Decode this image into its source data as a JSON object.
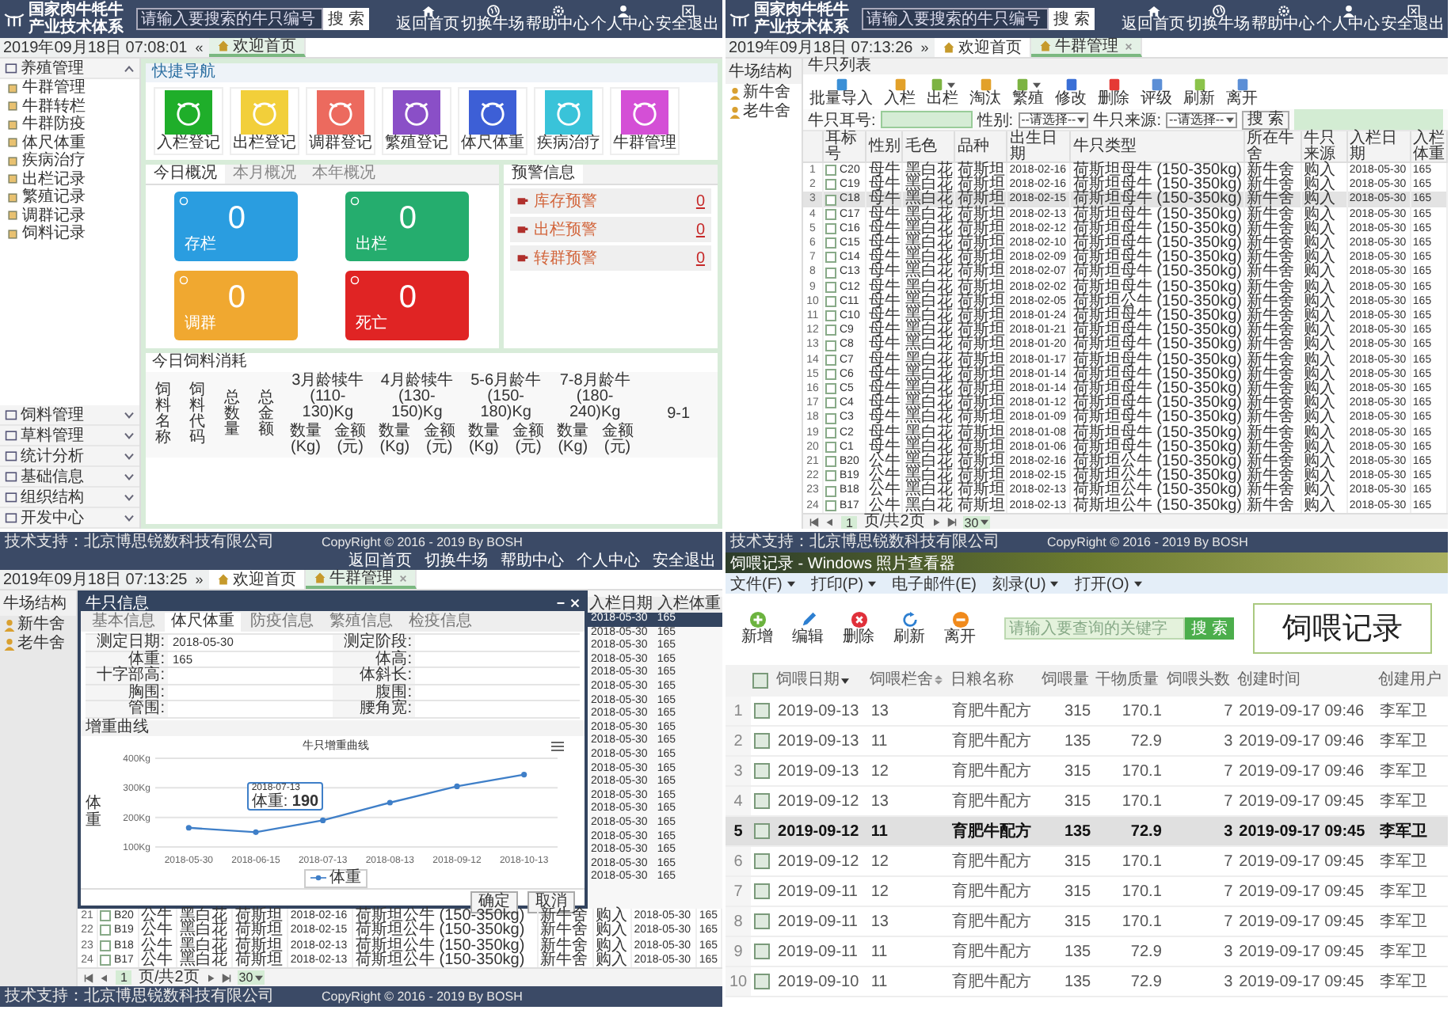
{
  "dashboard": {
    "header": {
      "title": "国家肉牛牦牛产业技术体系",
      "search_placeholder": "请输入要搜索的牛只编号",
      "search_button": "搜 索",
      "nav": [
        "返回首页",
        "切换牛场",
        "帮助中心",
        "个人中心",
        "安全退出"
      ]
    },
    "date": "2019年09月18日 07:08:01",
    "collapse": "«",
    "tabs": [
      {
        "label": "欢迎首页",
        "selected": true
      }
    ],
    "sidebar": [
      {
        "label": "养殖管理",
        "expanded": true,
        "items": [
          "牛群管理",
          "牛群转栏",
          "牛群防疫",
          "体尺体重",
          "疾病治疗",
          "出栏记录",
          "繁殖记录",
          "调群记录",
          "饲料记录"
        ]
      },
      {
        "label": "饲料管理",
        "expanded": false
      },
      {
        "label": "草料管理",
        "expanded": false
      },
      {
        "label": "统计分析",
        "expanded": false
      },
      {
        "label": "基础信息",
        "expanded": false
      },
      {
        "label": "组织结构",
        "expanded": false
      },
      {
        "label": "开发中心",
        "expanded": false
      }
    ],
    "quick_nav": {
      "title": "快捷导航",
      "tiles": [
        {
          "label": "入栏登记",
          "color": "#1fae2a"
        },
        {
          "label": "出栏登记",
          "color": "#f2cf3a"
        },
        {
          "label": "调群登记",
          "color": "#ec6a5e"
        },
        {
          "label": "繁殖登记",
          "color": "#8a4fc7"
        },
        {
          "label": "体尺体重",
          "color": "#3d5fd6"
        },
        {
          "label": "疾病治疗",
          "color": "#39c3d9"
        },
        {
          "label": "牛群管理",
          "color": "#d44fd6"
        }
      ]
    },
    "overview": {
      "tabs": [
        {
          "label": "今日概况",
          "selected": true
        },
        {
          "label": "本月概况",
          "selected": false
        },
        {
          "label": "本年概况",
          "selected": false
        }
      ],
      "cards": [
        {
          "value": "0",
          "label": "存栏",
          "color": "#2a9de0"
        },
        {
          "value": "0",
          "label": "出栏",
          "color": "#25ad6e"
        },
        {
          "value": "0",
          "label": "调群",
          "color": "#f0a830"
        },
        {
          "value": "0",
          "label": "死亡",
          "color": "#e02424"
        }
      ]
    },
    "warnings": {
      "title": "预警信息",
      "items": [
        {
          "label": "库存预警",
          "count": "0"
        },
        {
          "label": "出栏预警",
          "count": "0"
        },
        {
          "label": "转群预警",
          "count": "0"
        }
      ]
    },
    "feed": {
      "title": "今日饲料消耗",
      "columns": [
        "饲料名称",
        "饲料代码",
        "总数量",
        "总金额"
      ],
      "groups": [
        {
          "label": "3月龄犊牛(110-130)Kg",
          "sub": [
            "数量(Kg)",
            "金额(元)"
          ]
        },
        {
          "label": "4月龄犊牛(130-150)Kg",
          "sub": [
            "数量(Kg)",
            "金额(元)"
          ]
        },
        {
          "label": "5-6月龄牛(150-180)Kg",
          "sub": [
            "数量(Kg)",
            "金额(元)"
          ]
        },
        {
          "label": "7-8月龄牛(180-240)Kg",
          "sub": [
            "数量(Kg)",
            "金额(元)"
          ]
        },
        {
          "label": "9-1"
        }
      ]
    }
  },
  "cattle_list": {
    "header": {
      "title": "国家肉牛牦牛产业技术体系",
      "search_placeholder": "请输入要搜索的牛只编号",
      "search_button": "搜 索",
      "nav": [
        "返回首页",
        "切换牛场",
        "帮助中心",
        "个人中心",
        "安全退出"
      ]
    },
    "date": "2019年09月18日 07:13:26",
    "expand": "»",
    "tabs": [
      {
        "label": "欢迎首页",
        "selected": false,
        "closable": false
      },
      {
        "label": "牛群管理",
        "selected": true,
        "closable": true
      }
    ],
    "tree": {
      "title": "牛场结构",
      "items": [
        "新牛舍",
        "老牛舍"
      ]
    },
    "title": "牛只列表",
    "toolbar": [
      {
        "label": "批量导入",
        "color": "#3a8fd6",
        "dropdown": false
      },
      {
        "label": "入栏",
        "color": "#e2a12a",
        "dropdown": false
      },
      {
        "label": "出栏",
        "color": "#7cb342",
        "dropdown": true
      },
      {
        "label": "淘汰",
        "color": "#e2a12a",
        "dropdown": false
      },
      {
        "label": "繁殖",
        "color": "#7cb342",
        "dropdown": true
      },
      {
        "label": "修改",
        "color": "#3a6fd6",
        "dropdown": false
      },
      {
        "label": "删除",
        "color": "#e53935",
        "dropdown": false
      },
      {
        "label": "评级",
        "color": "#5c8fd6",
        "dropdown": false
      },
      {
        "label": "刷新",
        "color": "#8bc34a",
        "dropdown": false
      },
      {
        "label": "离开",
        "color": "#5c8fd6",
        "dropdown": false
      }
    ],
    "filter": {
      "ear_label": "牛只耳号:",
      "sex_label": "性别:",
      "sex_value": "--请选择--",
      "source_label": "牛只来源:",
      "source_value": "--请选择--",
      "button": "搜 索"
    },
    "columns": [
      "耳标号",
      "性别",
      "毛色",
      "品种",
      "出生日期",
      "牛只类型",
      "所在牛舍",
      "牛只来源",
      "入栏日期",
      "入栏体重"
    ],
    "rows": [
      {
        "n": "1",
        "tag": "C20",
        "sex": "母牛",
        "coat": "黑白花",
        "breed": "荷斯坦",
        "birth": "2018-02-16",
        "type": "荷斯坦母牛 (150-350kg)",
        "barn": "新牛舍",
        "source": "购入",
        "date": "2018-05-30",
        "weight": "165",
        "checked": false,
        "selected": false
      },
      {
        "n": "2",
        "tag": "C19",
        "sex": "母牛",
        "coat": "黑白花",
        "breed": "荷斯坦",
        "birth": "2018-02-16",
        "type": "荷斯坦母牛 (150-350kg)",
        "barn": "新牛舍",
        "source": "购入",
        "date": "2018-05-30",
        "weight": "165",
        "checked": false,
        "selected": false
      },
      {
        "n": "3",
        "tag": "C18",
        "sex": "母牛",
        "coat": "黑白花",
        "breed": "荷斯坦",
        "birth": "2018-02-15",
        "type": "荷斯坦母牛 (150-350kg)",
        "barn": "新牛舍",
        "source": "购入",
        "date": "2018-05-30",
        "weight": "165",
        "checked": false,
        "selected": true
      },
      {
        "n": "4",
        "tag": "C17",
        "sex": "母牛",
        "coat": "黑白花",
        "breed": "荷斯坦",
        "birth": "2018-02-13",
        "type": "荷斯坦母牛 (150-350kg)",
        "barn": "新牛舍",
        "source": "购入",
        "date": "2018-05-30",
        "weight": "165",
        "checked": false,
        "selected": false
      },
      {
        "n": "5",
        "tag": "C16",
        "sex": "母牛",
        "coat": "黑白花",
        "breed": "荷斯坦",
        "birth": "2018-02-12",
        "type": "荷斯坦母牛 (150-350kg)",
        "barn": "新牛舍",
        "source": "购入",
        "date": "2018-05-30",
        "weight": "165",
        "checked": false,
        "selected": false
      },
      {
        "n": "6",
        "tag": "C15",
        "sex": "母牛",
        "coat": "黑白花",
        "breed": "荷斯坦",
        "birth": "2018-02-10",
        "type": "荷斯坦母牛 (150-350kg)",
        "barn": "新牛舍",
        "source": "购入",
        "date": "2018-05-30",
        "weight": "165",
        "checked": false,
        "selected": false
      },
      {
        "n": "7",
        "tag": "C14",
        "sex": "母牛",
        "coat": "黑白花",
        "breed": "荷斯坦",
        "birth": "2018-02-09",
        "type": "荷斯坦母牛 (150-350kg)",
        "barn": "新牛舍",
        "source": "购入",
        "date": "2018-05-30",
        "weight": "165",
        "checked": false,
        "selected": false
      },
      {
        "n": "8",
        "tag": "C13",
        "sex": "母牛",
        "coat": "黑白花",
        "breed": "荷斯坦",
        "birth": "2018-02-07",
        "type": "荷斯坦母牛 (150-350kg)",
        "barn": "新牛舍",
        "source": "购入",
        "date": "2018-05-30",
        "weight": "165",
        "checked": false,
        "selected": false
      },
      {
        "n": "9",
        "tag": "C12",
        "sex": "母牛",
        "coat": "黑白花",
        "breed": "荷斯坦",
        "birth": "2018-02-02",
        "type": "荷斯坦母牛 (150-350kg)",
        "barn": "新牛舍",
        "source": "购入",
        "date": "2018-05-30",
        "weight": "165",
        "checked": false,
        "selected": false
      },
      {
        "n": "10",
        "tag": "C11",
        "sex": "母牛",
        "coat": "黑白花",
        "breed": "荷斯坦",
        "birth": "2018-02-05",
        "type": "荷斯坦公牛 (150-350kg)",
        "barn": "新牛舍",
        "source": "购入",
        "date": "2018-05-30",
        "weight": "165",
        "checked": false,
        "selected": false
      },
      {
        "n": "11",
        "tag": "C10",
        "sex": "母牛",
        "coat": "黑白花",
        "breed": "荷斯坦",
        "birth": "2018-01-24",
        "type": "荷斯坦母牛 (150-350kg)",
        "barn": "新牛舍",
        "source": "购入",
        "date": "2018-05-30",
        "weight": "165",
        "checked": false,
        "selected": false
      },
      {
        "n": "12",
        "tag": "C9",
        "sex": "母牛",
        "coat": "黑白花",
        "breed": "荷斯坦",
        "birth": "2018-01-21",
        "type": "荷斯坦母牛 (150-350kg)",
        "barn": "新牛舍",
        "source": "购入",
        "date": "2018-05-30",
        "weight": "165",
        "checked": false,
        "selected": false
      },
      {
        "n": "13",
        "tag": "C8",
        "sex": "母牛",
        "coat": "黑白花",
        "breed": "荷斯坦",
        "birth": "2018-01-20",
        "type": "荷斯坦母牛 (150-350kg)",
        "barn": "新牛舍",
        "source": "购入",
        "date": "2018-05-30",
        "weight": "165",
        "checked": false,
        "selected": false
      },
      {
        "n": "14",
        "tag": "C7",
        "sex": "母牛",
        "coat": "黑白花",
        "breed": "荷斯坦",
        "birth": "2018-01-17",
        "type": "荷斯坦母牛 (150-350kg)",
        "barn": "新牛舍",
        "source": "购入",
        "date": "2018-05-30",
        "weight": "165",
        "checked": false,
        "selected": false
      },
      {
        "n": "15",
        "tag": "C6",
        "sex": "母牛",
        "coat": "黑白花",
        "breed": "荷斯坦",
        "birth": "2018-01-14",
        "type": "荷斯坦母牛 (150-350kg)",
        "barn": "新牛舍",
        "source": "购入",
        "date": "2018-05-30",
        "weight": "165",
        "checked": false,
        "selected": false
      },
      {
        "n": "16",
        "tag": "C5",
        "sex": "母牛",
        "coat": "黑白花",
        "breed": "荷斯坦",
        "birth": "2018-01-14",
        "type": "荷斯坦母牛 (150-350kg)",
        "barn": "新牛舍",
        "source": "购入",
        "date": "2018-05-30",
        "weight": "165",
        "checked": false,
        "selected": false
      },
      {
        "n": "17",
        "tag": "C4",
        "sex": "母牛",
        "coat": "黑白花",
        "breed": "荷斯坦",
        "birth": "2018-01-12",
        "type": "荷斯坦母牛 (150-350kg)",
        "barn": "新牛舍",
        "source": "购入",
        "date": "2018-05-30",
        "weight": "165",
        "checked": false,
        "selected": false
      },
      {
        "n": "18",
        "tag": "C3",
        "sex": "母牛",
        "coat": "黑白花",
        "breed": "荷斯坦",
        "birth": "2018-01-09",
        "type": "荷斯坦母牛 (150-350kg)",
        "barn": "新牛舍",
        "source": "购入",
        "date": "2018-05-30",
        "weight": "165",
        "checked": false,
        "selected": false
      },
      {
        "n": "19",
        "tag": "C2",
        "sex": "母牛",
        "coat": "黑白花",
        "breed": "荷斯坦",
        "birth": "2018-01-08",
        "type": "荷斯坦母牛 (150-350kg)",
        "barn": "新牛舍",
        "source": "购入",
        "date": "2018-05-30",
        "weight": "165",
        "checked": false,
        "selected": false
      },
      {
        "n": "20",
        "tag": "C1",
        "sex": "母牛",
        "coat": "黑白花",
        "breed": "荷斯坦",
        "birth": "2018-01-06",
        "type": "荷斯坦母牛 (150-350kg)",
        "barn": "新牛舍",
        "source": "购入",
        "date": "2018-05-30",
        "weight": "165",
        "checked": false,
        "selected": false
      },
      {
        "n": "21",
        "tag": "B20",
        "sex": "公牛",
        "coat": "黑白花",
        "breed": "荷斯坦",
        "birth": "2018-02-16",
        "type": "荷斯坦公牛 (150-350kg)",
        "barn": "新牛舍",
        "source": "购入",
        "date": "2018-05-30",
        "weight": "165",
        "checked": false,
        "selected": false
      },
      {
        "n": "22",
        "tag": "B19",
        "sex": "公牛",
        "coat": "黑白花",
        "breed": "荷斯坦",
        "birth": "2018-02-15",
        "type": "荷斯坦公牛 (150-350kg)",
        "barn": "新牛舍",
        "source": "购入",
        "date": "2018-05-30",
        "weight": "165",
        "checked": false,
        "selected": false
      },
      {
        "n": "23",
        "tag": "B18",
        "sex": "公牛",
        "coat": "黑白花",
        "breed": "荷斯坦",
        "birth": "2018-02-13",
        "type": "荷斯坦公牛 (150-350kg)",
        "barn": "新牛舍",
        "source": "购入",
        "date": "2018-05-30",
        "weight": "165",
        "checked": false,
        "selected": false
      },
      {
        "n": "24",
        "tag": "B17",
        "sex": "公牛",
        "coat": "黑白花",
        "breed": "荷斯坦",
        "birth": "2018-02-13",
        "type": "荷斯坦公牛 (150-350kg)",
        "barn": "新牛舍",
        "source": "购入",
        "date": "2018-05-30",
        "weight": "165",
        "checked": false,
        "selected": false
      }
    ],
    "pager": {
      "page": "1",
      "text": "页/共2页",
      "size": "30"
    }
  },
  "cattle_modal": {
    "footer": {
      "left": "技术支持：北京博思锐数科技有限公司",
      "right": "CopyRight © 2016 - 2019 By BOSH"
    },
    "nav": [
      "返回首页",
      "切换牛场",
      "帮助中心",
      "个人中心",
      "安全退出"
    ],
    "date": "2019年09月18日 07:13:25",
    "expand": "»",
    "tabs": [
      {
        "label": "欢迎首页",
        "selected": false,
        "closable": false
      },
      {
        "label": "牛群管理",
        "selected": true,
        "closable": true
      }
    ],
    "tree": {
      "title": "牛场结构",
      "items": [
        "新牛舍",
        "老牛舍"
      ]
    },
    "modal": {
      "title": "牛只信息",
      "tabs": [
        {
          "label": "基本信息",
          "selected": false
        },
        {
          "label": "体尺体重",
          "selected": true
        },
        {
          "label": "防疫信息",
          "selected": false
        },
        {
          "label": "繁殖信息",
          "selected": false
        },
        {
          "label": "检疫信息",
          "selected": false
        }
      ],
      "fields": [
        {
          "label": "测定日期:",
          "value": "2018-05-30"
        },
        {
          "label": "测定阶段:"
        },
        {
          "label": "体重:",
          "value": "165"
        },
        {
          "label": "体高:"
        },
        {
          "label": "十字部高:"
        },
        {
          "label": "体斜长:"
        },
        {
          "label": "胸围:"
        },
        {
          "label": "腹围:"
        },
        {
          "label": "管围:"
        },
        {
          "label": "腰角宽:"
        }
      ],
      "section": "增重曲线",
      "chart_data": {
        "type": "line",
        "title": "牛只增重曲线",
        "ylabel": "体重",
        "categories": [
          "2018-05-30",
          "2018-06-15",
          "2018-07-13",
          "2018-08-13",
          "2018-09-12",
          "2018-10-13"
        ],
        "series": [
          {
            "name": "体重",
            "color": "#3f7fc8",
            "marker": "circle",
            "values": [
              165,
              150,
              190,
              250,
              305,
              345
            ]
          }
        ],
        "ylim": [
          100,
          400
        ],
        "yticks": [
          {
            "value": 100,
            "label": "100Kg"
          },
          {
            "value": 200,
            "label": "200Kg"
          },
          {
            "value": 300,
            "label": "300Kg"
          },
          {
            "value": 400,
            "label": "400Kg"
          }
        ],
        "annotations": [
          {
            "x": "2018-07-13",
            "y": 190,
            "text": "体重: **190**"
          }
        ]
      },
      "buttons": [
        "确定",
        "取消"
      ]
    },
    "side_columns": [
      "入栏日期",
      "入栏体重"
    ],
    "side_rows": [
      {
        "date": "2018-05-30",
        "weight": "165",
        "selected": true
      },
      {
        "date": "2018-05-30",
        "weight": "165",
        "selected": false
      },
      {
        "date": "2018-05-30",
        "weight": "165",
        "selected": false
      },
      {
        "date": "2018-05-30",
        "weight": "165",
        "selected": false
      },
      {
        "date": "2018-05-30",
        "weight": "165",
        "selected": false
      },
      {
        "date": "2018-05-30",
        "weight": "165",
        "selected": false
      },
      {
        "date": "2018-05-30",
        "weight": "165",
        "selected": false
      },
      {
        "date": "2018-05-30",
        "weight": "165",
        "selected": false
      },
      {
        "date": "2018-05-30",
        "weight": "165",
        "selected": false
      },
      {
        "date": "2018-05-30",
        "weight": "165",
        "selected": false
      },
      {
        "date": "2018-05-30",
        "weight": "165",
        "selected": false
      },
      {
        "date": "2018-05-30",
        "weight": "165",
        "selected": false
      },
      {
        "date": "2018-05-30",
        "weight": "165",
        "selected": false
      },
      {
        "date": "2018-05-30",
        "weight": "165",
        "selected": false
      },
      {
        "date": "2018-05-30",
        "weight": "165",
        "selected": false
      },
      {
        "date": "2018-05-30",
        "weight": "165",
        "selected": false
      },
      {
        "date": "2018-05-30",
        "weight": "165",
        "selected": false
      },
      {
        "date": "2018-05-30",
        "weight": "165",
        "selected": false
      },
      {
        "date": "2018-05-30",
        "weight": "165",
        "selected": false
      },
      {
        "date": "2018-05-30",
        "weight": "165",
        "selected": false
      }
    ],
    "rows": [
      {
        "n": "21",
        "tag": "B20",
        "sex": "公牛",
        "coat": "黑白花",
        "breed": "荷斯坦",
        "birth": "2018-02-16",
        "type": "荷斯坦公牛 (150-350kg)",
        "barn": "新牛舍",
        "source": "购入",
        "date": "2018-05-30",
        "weight": "165",
        "checked": false
      },
      {
        "n": "22",
        "tag": "B19",
        "sex": "公牛",
        "coat": "黑白花",
        "breed": "荷斯坦",
        "birth": "2018-02-15",
        "type": "荷斯坦公牛 (150-350kg)",
        "barn": "新牛舍",
        "source": "购入",
        "date": "2018-05-30",
        "weight": "165",
        "checked": false
      },
      {
        "n": "23",
        "tag": "B18",
        "sex": "公牛",
        "coat": "黑白花",
        "breed": "荷斯坦",
        "birth": "2018-02-13",
        "type": "荷斯坦公牛 (150-350kg)",
        "barn": "新牛舍",
        "source": "购入",
        "date": "2018-05-30",
        "weight": "165",
        "checked": false
      },
      {
        "n": "24",
        "tag": "B17",
        "sex": "公牛",
        "coat": "黑白花",
        "breed": "荷斯坦",
        "birth": "2018-02-13",
        "type": "荷斯坦公牛 (150-350kg)",
        "barn": "新牛舍",
        "source": "购入",
        "date": "2018-05-30",
        "weight": "165",
        "checked": false
      }
    ],
    "pager": {
      "page": "1",
      "text": "页/共2页",
      "size": "30"
    },
    "bottom_footer": {
      "left": "技术支持：北京博思锐数科技有限公司",
      "right": "CopyRight © 2016 - 2019 By BOSH"
    }
  },
  "feeding": {
    "footer": {
      "left": "技术支持：北京博思锐数科技有限公司",
      "right": "CopyRight © 2016 - 2019 By BOSH"
    },
    "window_title": "饲喂记录 - Windows 照片查看器",
    "menu": [
      {
        "label": "文件(F)",
        "dropdown": true
      },
      {
        "label": "打印(P)",
        "dropdown": true
      },
      {
        "label": "电子邮件(E)",
        "dropdown": false
      },
      {
        "label": "刻录(U)",
        "dropdown": true
      },
      {
        "label": "打开(O)",
        "dropdown": true
      }
    ],
    "toolbar": [
      {
        "label": "新增",
        "kind": "add"
      },
      {
        "label": "编辑",
        "kind": "edit"
      },
      {
        "label": "删除",
        "kind": "delete"
      },
      {
        "label": "刷新",
        "kind": "refresh"
      },
      {
        "label": "离开",
        "kind": "leave"
      }
    ],
    "search": {
      "placeholder": "请输入要查询的关键字",
      "button": "搜 索"
    },
    "caption": "饲喂记录",
    "header_checked": false,
    "columns": [
      {
        "label": "饲喂日期",
        "sorted": true,
        "sortable": true
      },
      {
        "label": "饲喂栏舍",
        "sorted": false,
        "sortable": true
      },
      {
        "label": "日粮名称",
        "sorted": false,
        "sortable": false
      },
      {
        "label": "饲喂量",
        "sorted": false,
        "sortable": false
      },
      {
        "label": "干物质量",
        "sorted": false,
        "sortable": false
      },
      {
        "label": "饲喂头数",
        "sorted": false,
        "sortable": false
      },
      {
        "label": "创建时间",
        "sorted": false,
        "sortable": false
      },
      {
        "label": "创建用户",
        "sorted": false,
        "sortable": false
      }
    ],
    "rows": [
      {
        "n": "1",
        "date": "2019-09-13",
        "pen": "13",
        "ration": "育肥牛配方",
        "amount": "315",
        "dry": "170.1",
        "heads": "7",
        "created": "2019-09-17 09:46",
        "user": "李军卫",
        "checked": false,
        "selected": false
      },
      {
        "n": "2",
        "date": "2019-09-13",
        "pen": "11",
        "ration": "育肥牛配方",
        "amount": "135",
        "dry": "72.9",
        "heads": "3",
        "created": "2019-09-17 09:46",
        "user": "李军卫",
        "checked": false,
        "selected": false
      },
      {
        "n": "3",
        "date": "2019-09-13",
        "pen": "12",
        "ration": "育肥牛配方",
        "amount": "315",
        "dry": "170.1",
        "heads": "7",
        "created": "2019-09-17 09:46",
        "user": "李军卫",
        "checked": false,
        "selected": false
      },
      {
        "n": "4",
        "date": "2019-09-12",
        "pen": "13",
        "ration": "育肥牛配方",
        "amount": "315",
        "dry": "170.1",
        "heads": "7",
        "created": "2019-09-17 09:45",
        "user": "李军卫",
        "checked": false,
        "selected": false
      },
      {
        "n": "5",
        "date": "2019-09-12",
        "pen": "11",
        "ration": "育肥牛配方",
        "amount": "135",
        "dry": "72.9",
        "heads": "3",
        "created": "2019-09-17 09:45",
        "user": "李军卫",
        "checked": false,
        "selected": true
      },
      {
        "n": "6",
        "date": "2019-09-12",
        "pen": "12",
        "ration": "育肥牛配方",
        "amount": "315",
        "dry": "170.1",
        "heads": "7",
        "created": "2019-09-17 09:45",
        "user": "李军卫",
        "checked": false,
        "selected": false
      },
      {
        "n": "7",
        "date": "2019-09-11",
        "pen": "12",
        "ration": "育肥牛配方",
        "amount": "315",
        "dry": "170.1",
        "heads": "7",
        "created": "2019-09-17 09:45",
        "user": "李军卫",
        "checked": false,
        "selected": false
      },
      {
        "n": "8",
        "date": "2019-09-11",
        "pen": "13",
        "ration": "育肥牛配方",
        "amount": "315",
        "dry": "170.1",
        "heads": "7",
        "created": "2019-09-17 09:45",
        "user": "李军卫",
        "checked": false,
        "selected": false
      },
      {
        "n": "9",
        "date": "2019-09-11",
        "pen": "11",
        "ration": "育肥牛配方",
        "amount": "135",
        "dry": "72.9",
        "heads": "3",
        "created": "2019-09-17 09:45",
        "user": "李军卫",
        "checked": false,
        "selected": false
      },
      {
        "n": "10",
        "date": "2019-09-10",
        "pen": "11",
        "ration": "育肥牛配方",
        "amount": "135",
        "dry": "72.9",
        "heads": "3",
        "created": "2019-09-17 09:45",
        "user": "李军卫",
        "checked": false,
        "selected": false
      }
    ]
  }
}
